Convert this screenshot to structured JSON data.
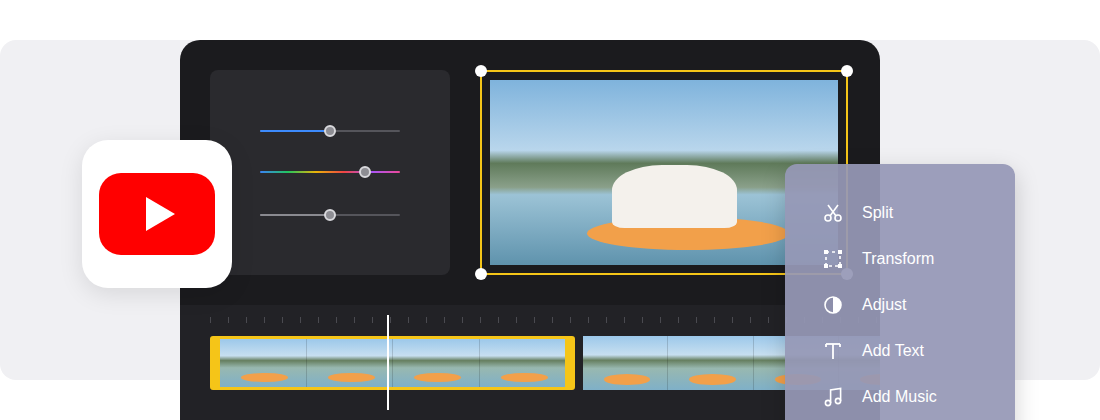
{
  "sliders": [
    {
      "kind": "solid",
      "level": 0.5,
      "color": "#3d8bfd"
    },
    {
      "kind": "spectrum",
      "level": 0.75
    },
    {
      "kind": "solid",
      "level": 0.5,
      "color": "#8a8a90"
    }
  ],
  "preview": {
    "selected": true
  },
  "timeline": {
    "playhead": {
      "level": 0.265
    },
    "clips": [
      {
        "selected": true
      },
      {
        "selected": false
      }
    ]
  },
  "menu": {
    "items": [
      {
        "label": "Split"
      },
      {
        "label": "Transform"
      },
      {
        "label": "Adjust"
      },
      {
        "label": "Add Text"
      },
      {
        "label": "Add Music"
      }
    ]
  }
}
